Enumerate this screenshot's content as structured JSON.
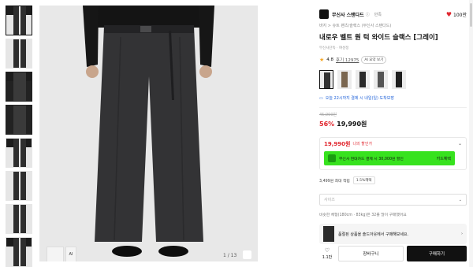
{
  "brand": {
    "name": "무신사 스탠다드",
    "tag": "만족",
    "like_count": "100만",
    "like_icon": "heart-icon"
  },
  "breadcrumb": "바지 > 슈트 팬츠/슬랙스 (무신사 스탠다드)",
  "product": {
    "title": "내로우 벨트 원 턱 와이드 슬랙스 [그레이]",
    "sub_brand": "무신사단독 · 여성정",
    "rating": "4.8",
    "reviews": "후기 12975",
    "ai_badge": "AI 요약 보기"
  },
  "delivery": "오늘 22시까지 결제 시 내일(일) 도착보장",
  "pricing": {
    "original": "45,900원",
    "discount": "56%",
    "price": "19,990원"
  },
  "coupon": {
    "price": "19,990원",
    "my_label": "나의 할인가",
    "green_text": "무신사 현대카드 결제 시 30,000원 할인",
    "green_action": "카드혜택"
  },
  "points": {
    "label": "3,499원 최대 적립",
    "tag": "1.5%혜택"
  },
  "size_select": {
    "placeholder": "사이즈"
  },
  "size_info": "비슷한 체형(180cm · 83kg)은 32를 많이 구매했어요",
  "promo": {
    "text": "품절된 상품을 솔드아웃에서 구매해보세요."
  },
  "gallery": {
    "page": "1 / 13",
    "mini_label": "AI"
  },
  "bottom": {
    "like_count": "1.1만",
    "cart": "장바구니",
    "buy": "구매하기"
  },
  "colors": {
    "accent_red": "#e0262e",
    "promo_green": "#37e21e",
    "buy_black": "#111111"
  }
}
